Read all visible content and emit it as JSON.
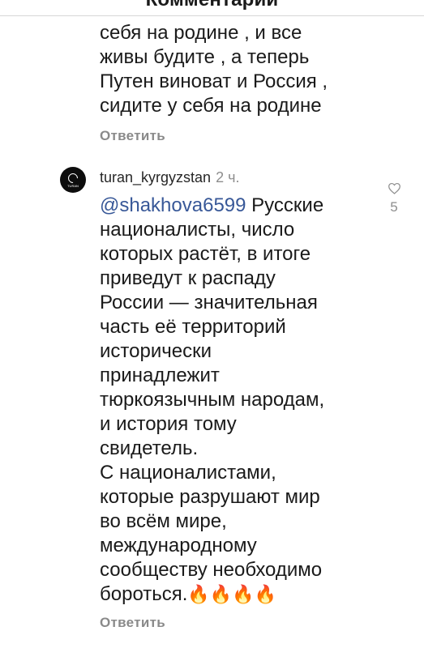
{
  "header": {
    "title": "Комментарии"
  },
  "prev_comment": {
    "text": "себя на родине , и все\nживы будите , а теперь\nПутен виноват и Россия ,\nсидите у себя на родине",
    "reply_label": "Ответить"
  },
  "comment": {
    "username": "turan_kyrgyzstan",
    "time": "2 ч.",
    "avatar_text": "TURAN",
    "mention": "@shakhova6599",
    "text": " Русские\nнационалисты, число\nкоторых растёт, в итоге\nприведут к распаду\nРоссии — значительная\nчасть её территорий\nисторически\nпринадлежит\nтюркоязычным народам,\nи история тому\nсвидетель.\nС националистами,\nкоторые разрушают мир\nво всём мире,\nмеждународному\nсообществу необходимо\nбороться.",
    "emoji": "🔥🔥🔥🔥",
    "reply_label": "Ответить",
    "likes": "5",
    "like_icon": "heart-outline-icon"
  }
}
